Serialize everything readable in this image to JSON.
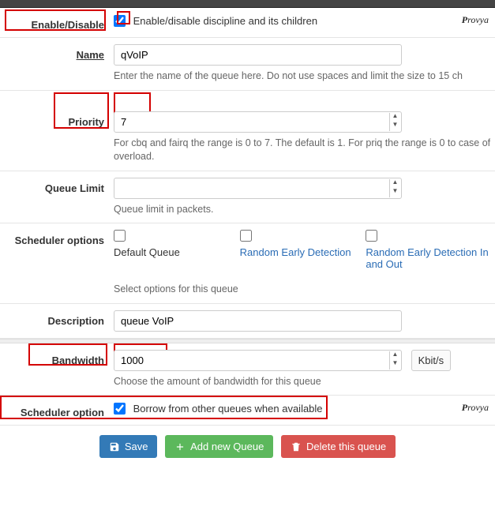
{
  "enable": {
    "label": "Enable/Disable",
    "checked": true,
    "text": "Enable/disable discipline and its children"
  },
  "name": {
    "label": "Name",
    "value": "qVoIP",
    "help": "Enter the name of the queue here. Do not use spaces and limit the size to 15 ch"
  },
  "priority": {
    "label": "Priority",
    "value": "7",
    "help": "For cbq and fairq the range is 0 to 7. The default is 1. For priq the range is 0 to case of overload."
  },
  "queue_limit": {
    "label": "Queue Limit",
    "value": "",
    "help": "Queue limit in packets."
  },
  "scheduler_options": {
    "label": "Scheduler options",
    "help": "Select options for this queue",
    "opts": [
      {
        "label": "Default Queue",
        "link": false
      },
      {
        "label": "Random Early Detection",
        "link": true
      },
      {
        "label": "Random Early Detection In and Out",
        "link": true
      }
    ]
  },
  "description": {
    "label": "Description",
    "value": "queue VoIP"
  },
  "bandwidth": {
    "label": "Bandwidth",
    "value": "1000",
    "unit": "Kbit/s",
    "help": "Choose the amount of bandwidth for this queue"
  },
  "scheduler_option": {
    "label": "Scheduler option",
    "checked": true,
    "text": "Borrow from other queues when available"
  },
  "buttons": {
    "save": "Save",
    "add": "Add new Queue",
    "delete": "Delete this queue"
  },
  "watermark": "Provya"
}
